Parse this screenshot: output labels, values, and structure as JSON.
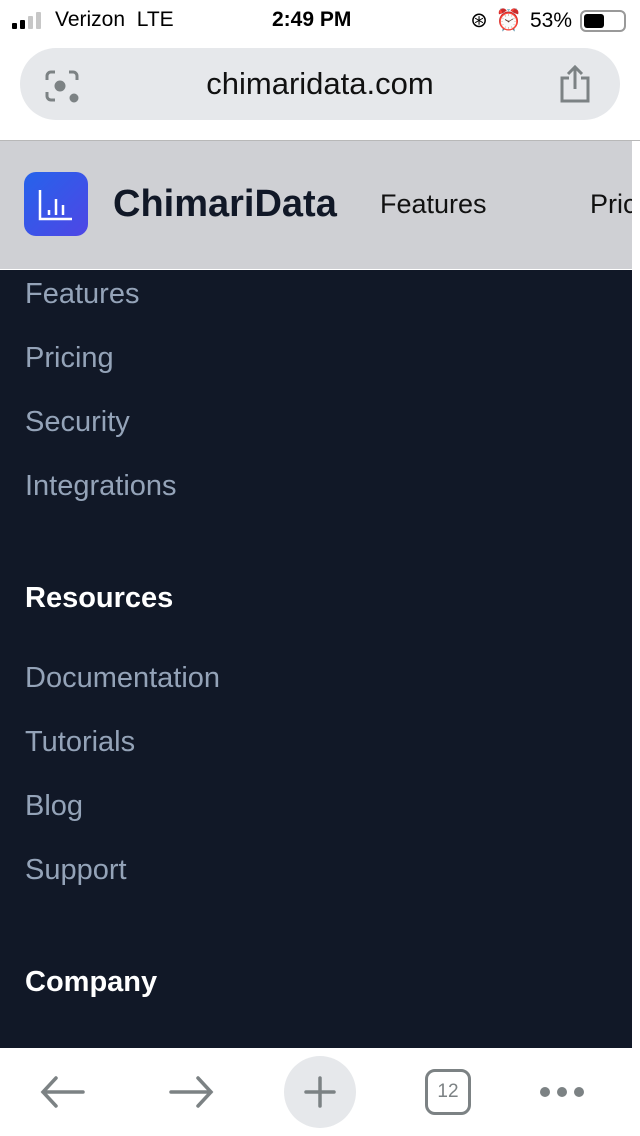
{
  "status": {
    "carrier": "Verizon  LTE",
    "time": "2:49 PM",
    "battery": "53%",
    "battery_level": 0.53
  },
  "browser": {
    "url": "chimaridata.com",
    "tab_count": "12"
  },
  "site": {
    "brand": "ChimariData",
    "nav": [
      "Features",
      "Pric"
    ]
  },
  "menu": {
    "product_links": [
      "Features",
      "Pricing",
      "Security",
      "Integrations"
    ],
    "resources_heading": "Resources",
    "resources_links": [
      "Documentation",
      "Tutorials",
      "Blog",
      "Support"
    ],
    "company_heading": "Company"
  }
}
